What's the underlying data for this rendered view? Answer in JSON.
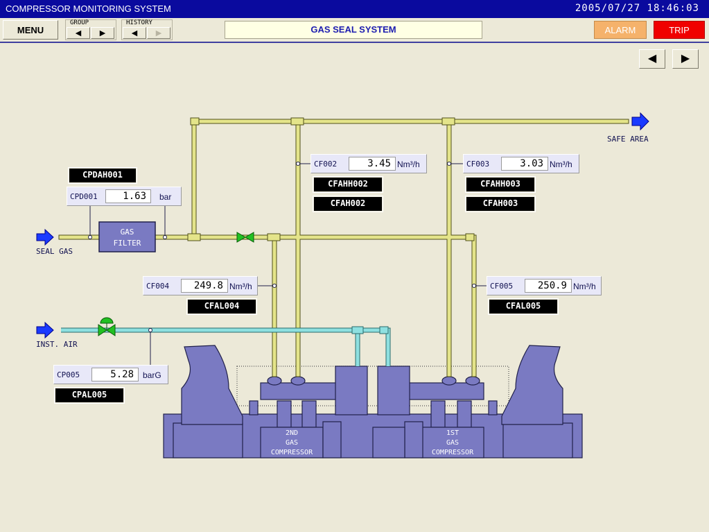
{
  "title_bar": {
    "app_title": "COMPRESSOR MONITORING SYSTEM",
    "datetime": "2005/07/27  18:46:03"
  },
  "toolbar": {
    "menu": "MENU",
    "group_label": "GROUP",
    "history_label": "HISTORY",
    "screen_title": "GAS SEAL SYSTEM",
    "alarm": "ALARM",
    "trip": "TRIP"
  },
  "labels": {
    "seal_gas": "SEAL GAS",
    "inst_air": "INST. AIR",
    "safe_area": "SAFE AREA",
    "gas_filter_1": "GAS",
    "gas_filter_2": "FILTER",
    "comp2_1": "2ND",
    "comp2_2": "GAS",
    "comp2_3": "COMPRESSOR",
    "comp1_1": "1ST",
    "comp1_2": "GAS",
    "comp1_3": "COMPRESSOR"
  },
  "instruments": {
    "cpd001": {
      "tag": "CPD001",
      "value": "1.63",
      "unit": "bar"
    },
    "cf002": {
      "tag": "CF002",
      "value": "3.45",
      "unit": "Nm³/h"
    },
    "cf003": {
      "tag": "CF003",
      "value": "3.03",
      "unit": "Nm³/h"
    },
    "cf004": {
      "tag": "CF004",
      "value": "249.8",
      "unit": "Nm³/h"
    },
    "cf005": {
      "tag": "CF005",
      "value": "250.9",
      "unit": "Nm³/h"
    },
    "cp005": {
      "tag": "CP005",
      "value": "5.28",
      "unit": "barG"
    }
  },
  "alarms": {
    "cpdah001": "CPDAH001",
    "cfahh002": "CFAHH002",
    "cfah002": "CFAH002",
    "cfahh003": "CFAHH003",
    "cfah003": "CFAH003",
    "cfal004": "CFAL004",
    "cfal005": "CFAL005",
    "cpal005": "CPAL005"
  },
  "colors": {
    "titlebar": "#0a0a9e",
    "pipe_gas": "#e4e48a",
    "pipe_air": "#8ee0e0",
    "equipment": "#7a7ac2",
    "valve": "#22c022",
    "arrow": "#1a3aff",
    "trip": "#f00000",
    "alarm": "#f5b26b"
  }
}
